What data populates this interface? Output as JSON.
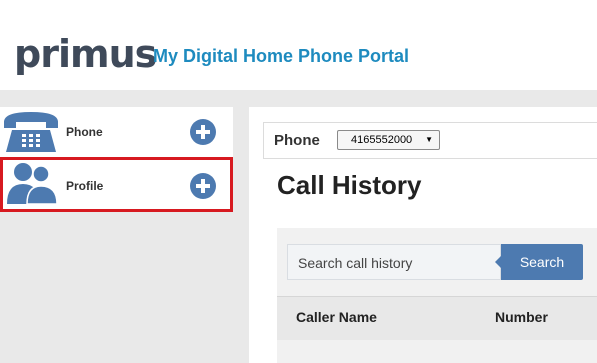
{
  "header": {
    "logo_text": "primus",
    "portal_title": "My Digital Home Phone Portal"
  },
  "sidebar": {
    "items": [
      {
        "label": "Phone",
        "icon": "telephone-icon"
      },
      {
        "label": "Profile",
        "icon": "people-icon"
      }
    ],
    "accent_color": "#4d7ab0",
    "highlight_color": "#d71920"
  },
  "main": {
    "phone_label": "Phone",
    "selected_phone": "4165552000",
    "heading": "Call History",
    "search": {
      "placeholder": "Search call history",
      "button_label": "Search"
    },
    "table": {
      "columns": [
        "Caller Name",
        "Number"
      ]
    }
  }
}
